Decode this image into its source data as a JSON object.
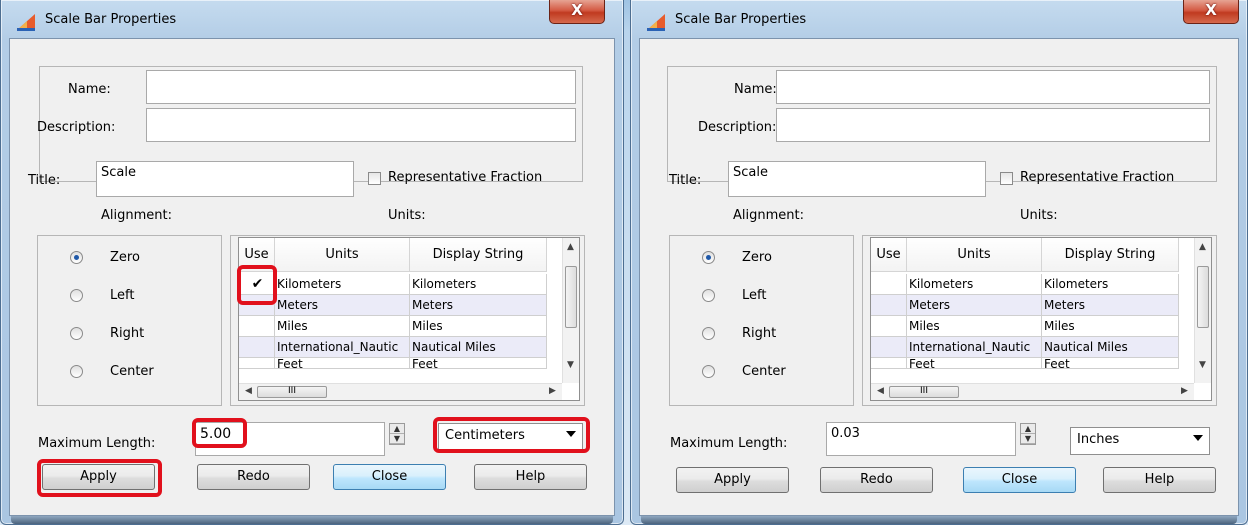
{
  "left_dialog": {
    "title": "Scale Bar Properties",
    "close_glyph": "X",
    "name_label": "Name:",
    "name_value": "",
    "description_label": "Description:",
    "description_value": "",
    "title_label": "Title:",
    "title_value": "Scale",
    "representative_fraction_label": "Representative Fraction",
    "alignment_label": "Alignment:",
    "units_label": "Units:",
    "alignment_options": [
      "Zero",
      "Left",
      "Right",
      "Center"
    ],
    "alignment_selected": "Zero",
    "units_table": {
      "headers": [
        "Use",
        "Units",
        "Display String"
      ],
      "rows": [
        {
          "use": true,
          "units": "Kilometers",
          "display": "Kilometers"
        },
        {
          "use": false,
          "units": "Meters",
          "display": "Meters"
        },
        {
          "use": false,
          "units": "Miles",
          "display": "Miles"
        },
        {
          "use": false,
          "units": "International_Nautic",
          "display": "Nautical Miles"
        },
        {
          "use": false,
          "units": "Feet",
          "display": "Feet"
        }
      ],
      "check_glyph": "✔",
      "hscroll_thumb_glyph": "III"
    },
    "max_length_label": "Maximum Length:",
    "max_length_value": "5.00",
    "max_length_units": "Centimeters",
    "buttons": {
      "apply": "Apply",
      "redo": "Redo",
      "close": "Close",
      "help": "Help"
    }
  },
  "right_dialog": {
    "title": "Scale Bar Properties",
    "close_glyph": "X",
    "name_label": "Name:",
    "name_value": "",
    "description_label": "Description:",
    "description_value": "",
    "title_label": "Title:",
    "title_value": "Scale",
    "representative_fraction_label": "Representative Fraction",
    "alignment_label": "Alignment:",
    "units_label": "Units:",
    "alignment_options": [
      "Zero",
      "Left",
      "Right",
      "Center"
    ],
    "alignment_selected": "Zero",
    "units_table": {
      "headers": [
        "Use",
        "Units",
        "Display String"
      ],
      "rows": [
        {
          "use": false,
          "units": "Kilometers",
          "display": "Kilometers"
        },
        {
          "use": false,
          "units": "Meters",
          "display": "Meters"
        },
        {
          "use": false,
          "units": "Miles",
          "display": "Miles"
        },
        {
          "use": false,
          "units": "International_Nautic",
          "display": "Nautical Miles"
        },
        {
          "use": false,
          "units": "Feet",
          "display": "Feet"
        }
      ],
      "check_glyph": "",
      "hscroll_thumb_glyph": "III"
    },
    "max_length_label": "Maximum Length:",
    "max_length_value": "0.03",
    "max_length_units": "Inches",
    "buttons": {
      "apply": "Apply",
      "redo": "Redo",
      "close": "Close",
      "help": "Help"
    }
  },
  "colors": {
    "highlight": "#e1101c",
    "title_bar": "#b3cde6",
    "close_button": "#c03a20",
    "default_button": "#bee6fd",
    "alt_row": "#ebebf8"
  },
  "icons": {
    "app_icon": "scale-bar-app-icon",
    "close": "close-icon",
    "dropdown": "chevron-down-icon"
  }
}
